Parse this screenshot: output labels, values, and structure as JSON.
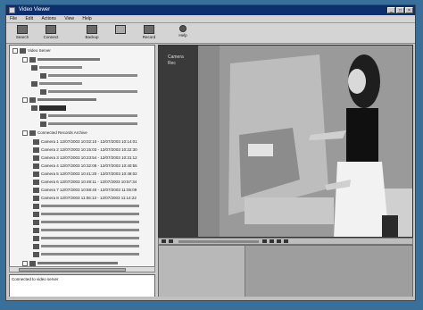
{
  "window": {
    "title": "Video Viewer"
  },
  "menu": [
    "File",
    "Edit",
    "Actions",
    "View",
    "Help"
  ],
  "toolbar": [
    "Search",
    "Connect",
    "Backup",
    "",
    "Record",
    "Help"
  ],
  "tree": {
    "root": "Video Server",
    "items": [
      "Connected Records Archive",
      "Camera 1 12/07/2003 10:02:10 - 12/07/2003 10:14:01",
      "Camera 2 12/07/2003 10:15:03 - 12/07/2003 10:22:30",
      "Camera 3 12/07/2003 10:23:54 - 12/07/2003 10:31:12",
      "Camera 4 12/07/2003 10:32:08 - 12/07/2003 10:40:55",
      "Camera 5 12/07/2003 10:41:20 - 12/07/2003 10:48:02",
      "Camera 6 12/07/2003 10:49:11 - 12/07/2003 10:57:34",
      "Camera 7 12/07/2003 10:58:40 - 12/07/2003 11:05:09",
      "Camera 8 12/07/2003 11:06:13 - 12/07/2003 11:14:22"
    ]
  },
  "log": {
    "text": "Connected to video server"
  },
  "video": {
    "overlay_line1": "Camera",
    "overlay_line2": "Rec"
  },
  "colors": {
    "title_bar": "#0d2f6e",
    "desktop": "#3a6f9a"
  }
}
